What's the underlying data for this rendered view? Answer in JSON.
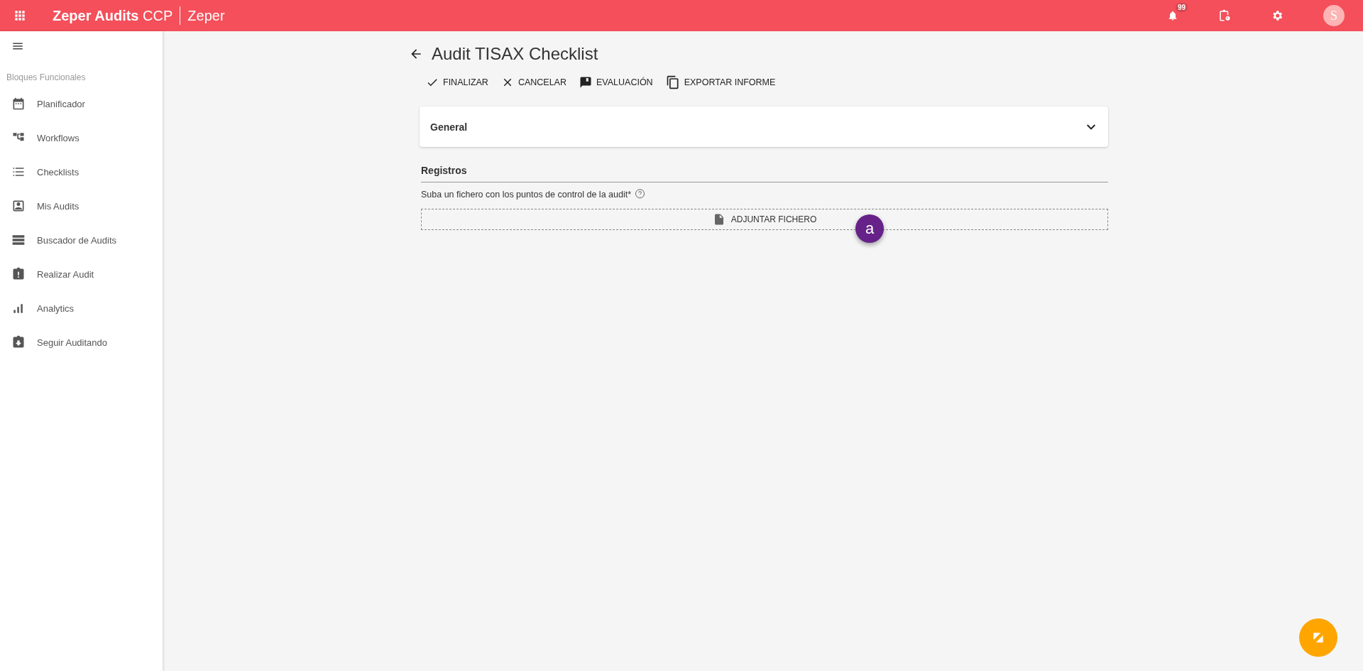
{
  "topbar": {
    "brand": "Zeper Audits",
    "brand_suffix": "CCP",
    "org": "Zeper",
    "notifications": "99",
    "avatar": "S"
  },
  "sidebar": {
    "section": "Bloques Funcionales",
    "items": [
      {
        "label": "Planificador",
        "kind": "calendar"
      },
      {
        "label": "Workflows",
        "kind": "flow"
      },
      {
        "label": "Checklists",
        "kind": "list"
      },
      {
        "label": "Mis Audits",
        "kind": "person"
      },
      {
        "label": "Buscador de Audits",
        "kind": "rows"
      },
      {
        "label": "Realizar Audit",
        "kind": "alert"
      },
      {
        "label": "Analytics",
        "kind": "bars"
      },
      {
        "label": "Seguir Auditando",
        "kind": "download"
      }
    ]
  },
  "page": {
    "title": "Audit TISAX Checklist",
    "actions": [
      {
        "label": "FINALIZAR",
        "kind": "check"
      },
      {
        "label": "CANCELAR",
        "kind": "close"
      },
      {
        "label": "EVALUACIÓN",
        "kind": "feedback"
      },
      {
        "label": "EXPORTAR INFORME",
        "kind": "copy"
      }
    ],
    "general": {
      "title": "General",
      "expanded": false
    },
    "section": "Registros",
    "upload_label": "Suba un fichero con los puntos de control de la audit*",
    "upload_button": "ADJUNTAR FICHERO",
    "marker": "a"
  }
}
